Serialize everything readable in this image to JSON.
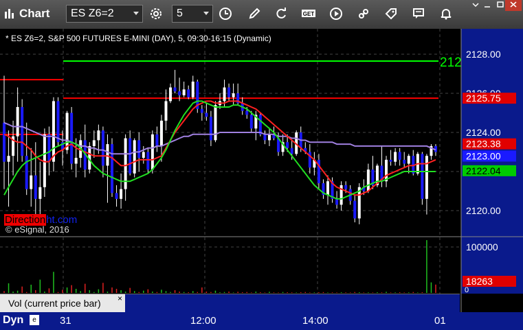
{
  "app": {
    "title": "Chart"
  },
  "toolbar": {
    "symbol": "ES Z6=2",
    "interval": "5",
    "buttons": [
      "settings-icon",
      "clock-icon",
      "pencil-icon",
      "refresh-icon",
      "get-icon",
      "play-icon",
      "tag-icon",
      "comment-icon",
      "bell-icon"
    ]
  },
  "chart_info": "* ES Z6=2, S&P 500 FUTURES E-MINI (DAY), 5, 09:30-16:15 (Dynamic)",
  "copyright": "© eSignal, 2016",
  "logo": {
    "part1": "Direction",
    "part2": "ht.com"
  },
  "volume_panel": {
    "label": "Vol (current price bar)",
    "close": "×",
    "zero_label": "0"
  },
  "status": {
    "mode": "Dyn"
  },
  "chart_data": {
    "type": "candlestick",
    "title": "",
    "x_labels": [
      "31",
      "12:00",
      "14:00",
      "01"
    ],
    "price_ticks": [
      "2128.00",
      "2126.00",
      "2124.00",
      "2122.00",
      "2120.00"
    ],
    "ylim": [
      2118.7,
      2129.3
    ],
    "price_tags": [
      {
        "value": "2125.75",
        "price": 2125.75,
        "bg": "#e00000",
        "fg": "#ffffff"
      },
      {
        "value": "2123.38",
        "price": 2123.38,
        "bg": "#e00000",
        "fg": "#ffffff"
      },
      {
        "value": "2123.00",
        "price": 2123.0,
        "bg": "#1a1aff",
        "fg": "#ffffff"
      },
      {
        "value": "2122.04",
        "price": 2122.04,
        "bg": "#00cc00",
        "fg": "#000000"
      }
    ],
    "top_level_label": "212",
    "volume_ticks": [
      "100000"
    ],
    "volume_tag": "18263",
    "volume_max": 115000,
    "colors": {
      "up": "#ffffff",
      "down": "#1a1aff",
      "ma_red": "#ff2020",
      "ma_green": "#20e020",
      "ma_purple": "#a080e0",
      "level_red": "#ff0000",
      "level_green": "#00ff00"
    },
    "horizontal_levels": [
      {
        "price": 2127.65,
        "color": "#00ff00"
      },
      {
        "price": 2125.75,
        "color": "#ff0000"
      },
      {
        "price": 2126.7,
        "color": "#ff0000",
        "partial": true
      },
      {
        "price": 2123.9,
        "color": "#ff0000",
        "partial": true
      }
    ],
    "candles": [
      [
        2124.5,
        2126.9,
        2121.1,
        2122.5
      ],
      [
        2122.5,
        2124.1,
        2120.2,
        2122.8
      ],
      [
        2122.8,
        2124.6,
        2121.8,
        2123.8
      ],
      [
        2123.8,
        2126.3,
        2122.5,
        2125.3
      ],
      [
        2125.3,
        2125.7,
        2122.5,
        2122.8
      ],
      [
        2122.8,
        2124.5,
        2120.8,
        2121.1
      ],
      [
        2121.1,
        2123.2,
        2120.2,
        2121.8
      ],
      [
        2121.8,
        2123.5,
        2119.7,
        2120.6
      ],
      [
        2120.6,
        2122.5,
        2119.5,
        2121.2
      ],
      [
        2121.2,
        2124.2,
        2120.7,
        2123.9
      ],
      [
        2123.9,
        2124.3,
        2121.8,
        2122.5
      ],
      [
        2122.5,
        2125.8,
        2122.0,
        2125.6
      ],
      [
        2125.6,
        2125.8,
        2123.3,
        2123.5
      ],
      [
        2123.5,
        2124.1,
        2122.3,
        2123.1
      ],
      [
        2123.1,
        2125.1,
        2122.9,
        2125.0
      ],
      [
        2125.0,
        2125.3,
        2122.1,
        2122.4
      ],
      [
        2122.4,
        2123.7,
        2121.7,
        2122.7
      ],
      [
        2122.7,
        2123.9,
        2122.2,
        2123.6
      ],
      [
        2123.6,
        2124.4,
        2121.7,
        2122.1
      ],
      [
        2122.1,
        2123.5,
        2121.9,
        2123.3
      ],
      [
        2123.3,
        2124.1,
        2122.7,
        2123.6
      ],
      [
        2123.6,
        2124.4,
        2122.9,
        2124.1
      ],
      [
        2124.1,
        2124.3,
        2121.7,
        2122.3
      ],
      [
        2122.3,
        2123.9,
        2120.4,
        2123.4
      ],
      [
        2123.4,
        2123.7,
        2120.7,
        2120.9
      ],
      [
        2120.9,
        2121.3,
        2120.2,
        2120.6
      ],
      [
        2120.6,
        2121.9,
        2120.1,
        2121.1
      ],
      [
        2121.1,
        2123.9,
        2120.5,
        2123.7
      ],
      [
        2123.7,
        2124.1,
        2121.8,
        2121.9
      ],
      [
        2121.9,
        2123.7,
        2121.7,
        2123.6
      ],
      [
        2123.6,
        2124.0,
        2122.0,
        2122.7
      ],
      [
        2122.7,
        2123.3,
        2122.4,
        2123.0
      ],
      [
        2123.0,
        2123.2,
        2121.9,
        2122.1
      ],
      [
        2122.1,
        2124.1,
        2121.9,
        2123.9
      ],
      [
        2123.9,
        2124.3,
        2123.0,
        2123.3
      ],
      [
        2123.3,
        2124.9,
        2122.5,
        2124.6
      ],
      [
        2124.6,
        2126.2,
        2124.1,
        2125.6
      ],
      [
        2125.6,
        2126.5,
        2125.5,
        2126.3
      ],
      [
        2126.3,
        2127.2,
        2126.0,
        2126.1
      ],
      [
        2126.1,
        2126.8,
        2125.6,
        2125.9
      ],
      [
        2125.9,
        2126.6,
        2125.8,
        2126.2
      ],
      [
        2126.2,
        2126.4,
        2125.7,
        2125.8
      ],
      [
        2125.8,
        2126.9,
        2125.7,
        2126.6
      ],
      [
        2126.6,
        2126.7,
        2125.0,
        2125.2
      ],
      [
        2125.2,
        2125.4,
        2124.6,
        2125.0
      ],
      [
        2125.0,
        2125.5,
        2124.6,
        2124.8
      ],
      [
        2124.8,
        2125.1,
        2123.3,
        2123.6
      ],
      [
        2123.6,
        2125.6,
        2123.5,
        2125.4
      ],
      [
        2125.4,
        2126.0,
        2125.2,
        2125.6
      ],
      [
        2125.6,
        2126.7,
        2125.3,
        2126.3
      ],
      [
        2126.3,
        2126.5,
        2125.6,
        2125.8
      ],
      [
        2125.8,
        2126.5,
        2125.4,
        2126.0
      ],
      [
        2126.0,
        2126.5,
        2125.4,
        2125.5
      ],
      [
        2125.5,
        2125.8,
        2124.9,
        2125.1
      ],
      [
        2125.1,
        2125.3,
        2124.7,
        2124.9
      ],
      [
        2124.9,
        2125.1,
        2124.0,
        2124.2
      ],
      [
        2124.2,
        2125.1,
        2123.6,
        2124.9
      ],
      [
        2124.9,
        2125.0,
        2123.8,
        2123.9
      ],
      [
        2123.9,
        2124.1,
        2123.4,
        2123.6
      ],
      [
        2123.6,
        2124.2,
        2123.3,
        2123.9
      ],
      [
        2123.9,
        2124.3,
        2123.6,
        2123.7
      ],
      [
        2123.7,
        2124.0,
        2122.8,
        2123.0
      ],
      [
        2123.0,
        2123.9,
        2122.8,
        2123.5
      ],
      [
        2123.5,
        2123.9,
        2123.0,
        2123.2
      ],
      [
        2123.2,
        2123.6,
        2122.6,
        2122.9
      ],
      [
        2122.9,
        2124.1,
        2122.8,
        2124.0
      ],
      [
        2124.0,
        2124.3,
        2123.0,
        2123.2
      ],
      [
        2123.2,
        2123.5,
        2122.9,
        2123.0
      ],
      [
        2123.0,
        2123.4,
        2121.9,
        2122.2
      ],
      [
        2122.2,
        2123.0,
        2121.8,
        2122.6
      ],
      [
        2122.6,
        2122.9,
        2121.1,
        2121.4
      ],
      [
        2121.4,
        2121.6,
        2120.6,
        2120.8
      ],
      [
        2120.8,
        2121.8,
        2120.3,
        2121.5
      ],
      [
        2121.5,
        2121.7,
        2120.4,
        2120.6
      ],
      [
        2120.6,
        2121.0,
        2120.1,
        2120.3
      ],
      [
        2120.3,
        2121.5,
        2120.0,
        2121.3
      ],
      [
        2121.3,
        2121.5,
        2120.9,
        2121.1
      ],
      [
        2121.1,
        2121.3,
        2120.3,
        2120.5
      ],
      [
        2120.5,
        2120.8,
        2119.4,
        2119.6
      ],
      [
        2119.6,
        2121.4,
        2119.3,
        2121.2
      ],
      [
        2121.2,
        2121.6,
        2120.8,
        2121.0
      ],
      [
        2121.0,
        2122.4,
        2120.9,
        2122.1
      ],
      [
        2122.1,
        2122.8,
        2121.1,
        2121.3
      ],
      [
        2121.3,
        2122.4,
        2121.2,
        2122.3
      ],
      [
        2122.3,
        2123.3,
        2121.2,
        2121.5
      ],
      [
        2121.5,
        2122.8,
        2121.2,
        2122.6
      ],
      [
        2122.6,
        2123.1,
        2122.3,
        2122.5
      ],
      [
        2122.5,
        2123.2,
        2122.3,
        2123.0
      ],
      [
        2123.0,
        2123.2,
        2122.3,
        2122.6
      ],
      [
        2122.6,
        2123.0,
        2122.2,
        2122.4
      ],
      [
        2122.4,
        2122.9,
        2121.9,
        2122.8
      ],
      [
        2122.8,
        2123.1,
        2121.8,
        2121.9
      ],
      [
        2121.9,
        2123.0,
        2121.8,
        2122.9
      ],
      [
        2122.9,
        2123.0,
        2120.3,
        2120.6
      ],
      [
        2120.6,
        2122.9,
        2119.8,
        2122.8
      ],
      [
        2122.8,
        2123.4,
        2122.6,
        2123.3
      ],
      [
        2123.3,
        2123.4,
        2122.8,
        2123.0
      ]
    ],
    "ma_red": [
      2123.9,
      2123.8,
      2123.6,
      2123.5,
      2123.5,
      2123.3,
      2123.1,
      2122.8,
      2122.6,
      2122.5,
      2122.5,
      2122.8,
      2123.0,
      2123.1,
      2123.3,
      2123.4,
      2123.2,
      2123.1,
      2123.0,
      2122.9,
      2122.8,
      2122.8,
      2122.8,
      2122.8,
      2122.7,
      2122.5,
      2122.3,
      2122.3,
      2122.4,
      2122.5,
      2122.6,
      2122.6,
      2122.6,
      2122.6,
      2122.7,
      2122.8,
      2123.2,
      2123.6,
      2124.0,
      2124.3,
      2124.6,
      2124.9,
      2125.2,
      2125.4,
      2125.5,
      2125.6,
      2125.6,
      2125.5,
      2125.5,
      2125.5,
      2125.6,
      2125.6,
      2125.6,
      2125.5,
      2125.4,
      2125.3,
      2125.2,
      2125.0,
      2124.8,
      2124.6,
      2124.4,
      2124.2,
      2124.0,
      2123.8,
      2123.6,
      2123.4,
      2123.2,
      2123.0,
      2122.8,
      2122.6,
      2122.3,
      2122.0,
      2121.7,
      2121.4,
      2121.2,
      2121.1,
      2121.0,
      2120.9,
      2120.8,
      2120.8,
      2120.9,
      2121.0,
      2121.2,
      2121.4,
      2121.6,
      2121.8,
      2121.9,
      2122.0,
      2122.1,
      2122.2,
      2122.3,
      2122.3,
      2122.4,
      2122.4,
      2122.4,
      2122.5,
      2122.6
    ],
    "ma_green": [
      2120.8,
      2121.2,
      2121.6,
      2122.0,
      2122.3,
      2122.5,
      2122.6,
      2122.7,
      2122.8,
      2122.9,
      2123.0,
      2123.2,
      2123.3,
      2123.4,
      2123.5,
      2123.5,
      2123.4,
      2123.2,
      2122.9,
      2122.6,
      2122.3,
      2122.1,
      2121.9,
      2121.8,
      2121.7,
      2121.6,
      2121.5,
      2121.5,
      2121.5,
      2121.6,
      2121.7,
      2121.8,
      2121.9,
      2122.1,
      2122.4,
      2122.7,
      2123.1,
      2123.6,
      2124.1,
      2124.5,
      2124.9,
      2125.2,
      2125.5,
      2125.6,
      2125.6,
      2125.5,
      2125.4,
      2125.3,
      2125.3,
      2125.3,
      2125.3,
      2125.4,
      2125.4,
      2125.3,
      2125.2,
      2125.0,
      2124.8,
      2124.6,
      2124.4,
      2124.2,
      2124.0,
      2123.7,
      2123.4,
      2123.1,
      2122.8,
      2122.5,
      2122.2,
      2121.9,
      2121.6,
      2121.3,
      2121.1,
      2120.9,
      2120.8,
      2120.7,
      2120.6,
      2120.6,
      2120.7,
      2120.8,
      2120.9,
      2121.0,
      2121.2,
      2121.3,
      2121.4,
      2121.5,
      2121.5,
      2121.6,
      2121.7,
      2121.8,
      2121.9,
      2122.0,
      2122.0,
      2122.0,
      2122.0,
      2122.0,
      2122.0,
      2122.0,
      2122.0
    ],
    "ma_purple": [
      2124.5,
      2124.4,
      2124.3,
      2124.3,
      2124.3,
      2124.2,
      2124.1,
      2124.0,
      2123.9,
      2123.8,
      2123.8,
      2123.8,
      2123.7,
      2123.6,
      2123.6,
      2123.5,
      2123.4,
      2123.3,
      2123.3,
      2123.2,
      2123.2,
      2123.1,
      2123.1,
      2123.0,
      2122.9,
      2122.9,
      2122.9,
      2122.9,
      2122.9,
      2123.0,
      2123.0,
      2123.1,
      2123.2,
      2123.2,
      2123.3,
      2123.3,
      2123.4,
      2123.5,
      2123.6,
      2123.7,
      2123.8,
      2123.8,
      2123.9,
      2123.9,
      2123.9,
      2123.9,
      2123.9,
      2123.9,
      2124.0,
      2124.0,
      2124.0,
      2124.0,
      2124.0,
      2124.0,
      2124.0,
      2124.0,
      2124.0,
      2124.0,
      2123.9,
      2123.9,
      2123.9,
      2123.8,
      2123.8,
      2123.8,
      2123.7,
      2123.7,
      2123.6,
      2123.6,
      2123.5,
      2123.5,
      2123.5,
      2123.5,
      2123.5,
      2123.5,
      2123.4,
      2123.4,
      2123.4,
      2123.4,
      2123.3,
      2123.3,
      2123.3,
      2123.3,
      2123.3,
      2123.3,
      2123.3,
      2123.3,
      2123.3,
      2123.3,
      2123.3,
      2123.3,
      2123.3,
      2123.3,
      2123.3,
      2123.3,
      2123.3,
      2123.2,
      2123.1
    ],
    "volume": [
      4000,
      21000,
      3000,
      5000,
      14000,
      2000,
      18000,
      6000,
      29000,
      3000,
      10000,
      46000,
      2000,
      7000,
      12000,
      17000,
      9000,
      4000,
      20000,
      6000,
      2000,
      8000,
      22000,
      3000,
      12000,
      9000,
      6000,
      3000,
      11000,
      4000,
      2000,
      5000,
      8000,
      3000,
      2000,
      7000,
      4000,
      2000,
      6000,
      3000,
      2000,
      1500,
      4000,
      2000,
      12000,
      3000,
      2000,
      5000,
      1500,
      2000,
      3000,
      1000,
      2500,
      1500,
      2000,
      1000,
      3000,
      1500,
      1000,
      2500,
      1200,
      1000,
      2000,
      1500,
      1200,
      1000,
      1500,
      2000,
      1000,
      1200,
      1500,
      1800,
      1000,
      1200,
      1000,
      1500,
      1200,
      1000,
      2000,
      1500,
      1000,
      1200,
      1000,
      1500,
      1200,
      2500,
      1000,
      1200,
      1500,
      1000,
      1200,
      2000,
      1000,
      1500,
      115000,
      23000,
      18263
    ]
  }
}
